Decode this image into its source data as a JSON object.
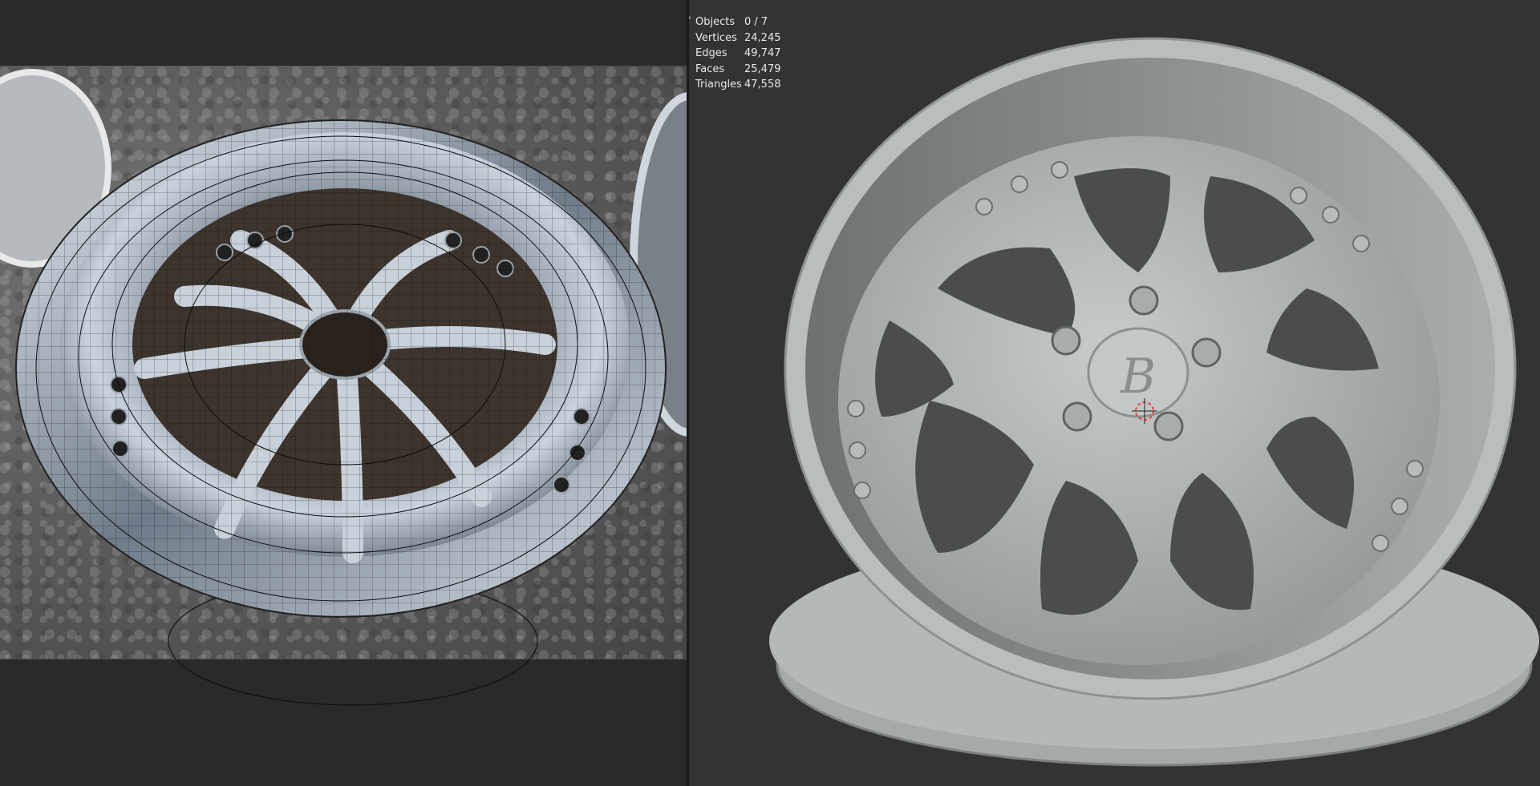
{
  "stats": {
    "rows": [
      {
        "label": "Objects",
        "value": "0 / 7"
      },
      {
        "label": "Vertices",
        "value": "24,245"
      },
      {
        "label": "Edges",
        "value": "49,747"
      },
      {
        "label": "Faces",
        "value": "25,479"
      },
      {
        "label": "Triangles",
        "value": "47,558"
      }
    ]
  },
  "colors": {
    "viewport_bg": "#333333",
    "left_bg": "#2a2a2a",
    "wheel_gray": "#b8bcba",
    "chrome": "#8d97a4",
    "wire": "#1a1a1a"
  },
  "icons": {
    "viewport_corner": "corner-arrow-icon",
    "cursor": "3d-cursor-icon",
    "logo": "brand-logo-icon"
  }
}
